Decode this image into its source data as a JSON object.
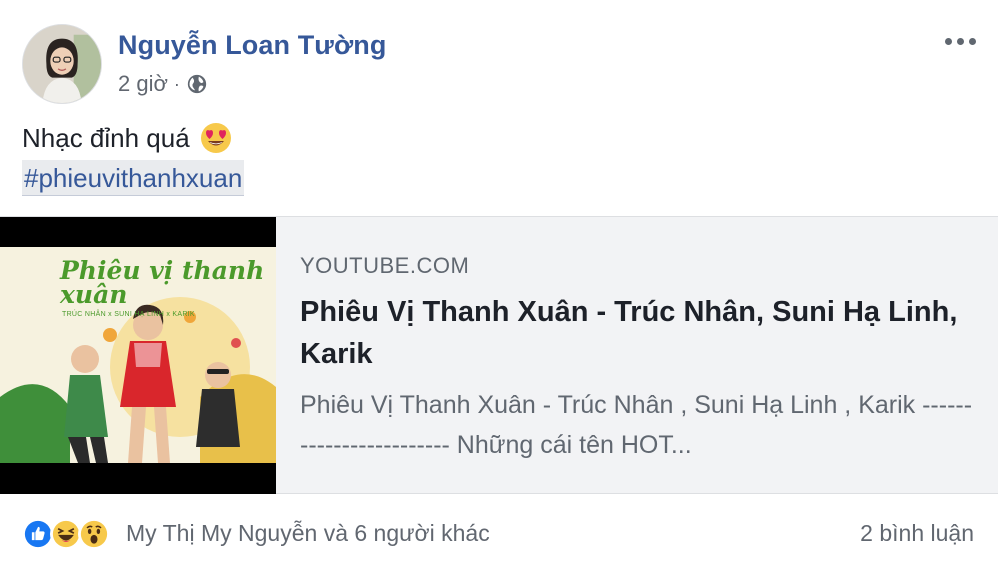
{
  "post": {
    "author": "Nguyễn Loan Tường",
    "time": "2 giờ",
    "separator": "·",
    "audience_icon": "globe-icon",
    "more_icon": "more-options-icon",
    "message": "Nhạc đỉnh quá",
    "message_emoji": "heart-eyes-emoji-icon",
    "hashtag": "#phieuvithanhxuan"
  },
  "link": {
    "domain": "YOUTUBE.COM",
    "title": "Phiêu Vị Thanh Xuân - Trúc Nhân, Suni Hạ Linh, Karik",
    "description": "Phiêu Vị Thanh Xuân - Trúc Nhân , Suni Hạ Linh , Karik ------------------------ Những cái tên HOT...",
    "thumbnail": {
      "title": "Phiêu vị thanh xuân",
      "subtitle": "TRÚC NHÂN x SUNI HẠ LINH x KARIK"
    }
  },
  "footer": {
    "reactions": [
      "like-reaction-icon",
      "haha-reaction-icon",
      "wow-reaction-icon"
    ],
    "reactors": "My Thị My Nguyễn và 6 người khác",
    "comments": "2 bình luận"
  },
  "colors": {
    "author_link": "#365899",
    "meta_text": "#616770",
    "card_bg": "#f2f3f5",
    "like_blue": "#1877f2",
    "reaction_yellow": "#f7c94b"
  }
}
